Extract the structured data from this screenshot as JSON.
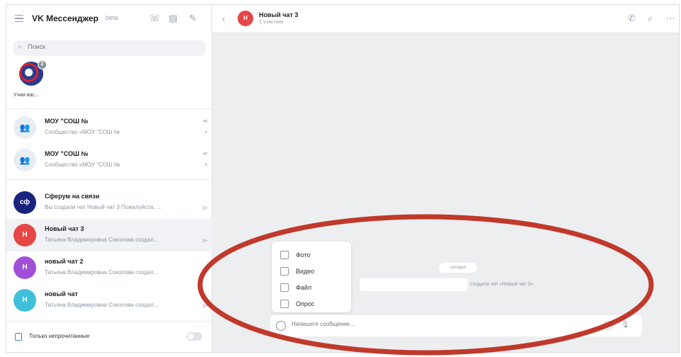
{
  "app": {
    "title": "VK Мессенджер",
    "badge": "beta"
  },
  "sidebar": {
    "search": {
      "placeholder": "Поиск"
    },
    "story": {
      "label": "Учим вас...",
      "count": "2"
    },
    "chats": [
      {
        "name": "МОУ \"СОШ №",
        "preview": "Сообщество «МОУ \"СОШ №",
        "avatar_text": "👥",
        "meta_top": "≪",
        "meta_bottom": "↗"
      },
      {
        "name": "МОУ \"СОШ №",
        "preview": "Сообщество «МОУ \"СОШ №",
        "avatar_text": "👥",
        "meta_top": "≪",
        "meta_bottom": "↗"
      },
      {
        "name": "Сферум на связи",
        "preview": "Вы создали чат Новый чат 3 Пожалуйста, ...",
        "avatar_text": "сф",
        "avatar_color": "#1a237e",
        "meta_top": "3+"
      },
      {
        "name": "Новый чат 3",
        "preview": "Татьяна Владимировна Соколова создал...",
        "avatar_text": "Н",
        "avatar_color": "#e64646",
        "meta_top": "3+"
      },
      {
        "name": "новый чат 2",
        "preview": "Татьяна Владимировна Соколова создал...",
        "avatar_text": "Н",
        "avatar_color": "#a24fd8",
        "meta_top": ""
      },
      {
        "name": "новый чат",
        "preview": "Татьяна Владимировна Соколова создал...",
        "avatar_text": "Н",
        "avatar_color": "#3fc0d8",
        "meta_top": "3+"
      }
    ],
    "filter_label": "Только непрочитанные"
  },
  "chat": {
    "title": "Новый чат 3",
    "subtitle": "1 участник",
    "avatar_text": "Н",
    "date_pill": "сегодня",
    "service_text": "создала чат «Новый чат 3»",
    "attach_menu": [
      "Фото",
      "Видео",
      "Файл",
      "Опрос"
    ],
    "composer_placeholder": "Напишите сообщение..."
  },
  "colors": {
    "accent": "#5181b8",
    "highlight": "#c0392b"
  }
}
